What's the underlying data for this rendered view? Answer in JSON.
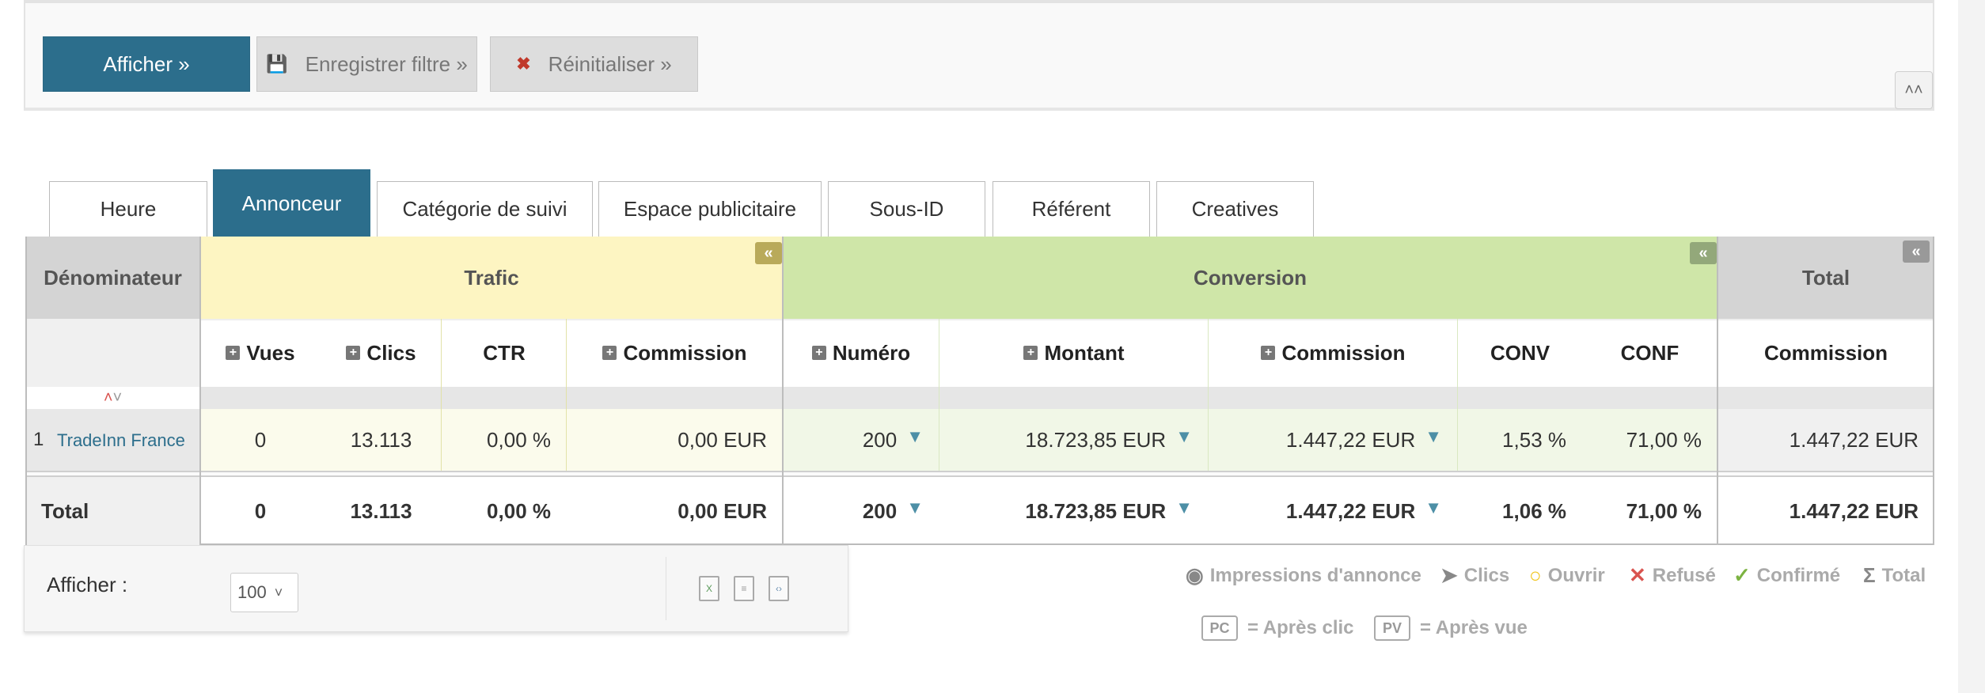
{
  "filter": {
    "show_btn": "Afficher »",
    "save_btn": "Enregistrer filtre »",
    "reset_btn": "Réinitialiser »",
    "collapse_icon": "double-chevron-up-icon"
  },
  "tabs": [
    {
      "label": "Heure",
      "active": false
    },
    {
      "label": "Annonceur",
      "active": true
    },
    {
      "label": "Catégorie de suivi",
      "active": false
    },
    {
      "label": "Espace publicitaire",
      "active": false
    },
    {
      "label": "Sous-ID",
      "active": false
    },
    {
      "label": "Référent",
      "active": false
    },
    {
      "label": "Creatives",
      "active": false
    }
  ],
  "table": {
    "groups": {
      "denominator": "Dénominateur",
      "traffic": "Trafic",
      "conversion": "Conversion",
      "total": "Total"
    },
    "columns": {
      "views": "Vues",
      "clicks": "Clics",
      "ctr": "CTR",
      "commission_traffic": "Commission",
      "number": "Numéro",
      "amount": "Montant",
      "commission_conv": "Commission",
      "conv": "CONV",
      "conf": "CONF",
      "commission_total": "Commission"
    },
    "rows": [
      {
        "index": "1",
        "name": "TradeInn France",
        "views": "0",
        "clicks": "13.113",
        "ctr": "0,00 %",
        "commission_traffic": "0,00 EUR",
        "number": "200",
        "amount": "18.723,85 EUR",
        "commission_conv": "1.447,22 EUR",
        "conv": "1,53 %",
        "conf": "71,00 %",
        "commission_total": "1.447,22 EUR"
      }
    ],
    "total": {
      "label": "Total",
      "views": "0",
      "clicks": "13.113",
      "ctr": "0,00 %",
      "commission_traffic": "0,00 EUR",
      "number": "200",
      "amount": "18.723,85 EUR",
      "commission_conv": "1.447,22 EUR",
      "conv": "1,06 %",
      "conf": "71,00 %",
      "commission_total": "1.447,22 EUR"
    },
    "colors": {
      "traffic_header": "#fdf5c2",
      "conversion_header": "#cfe6a8",
      "total_header": "#d4d4d4",
      "traffic_row": "#fbfbec",
      "conversion_row": "#f1f7e7",
      "total_row": "#f0f0f0"
    }
  },
  "footer": {
    "show_label": "Afficher :",
    "page_size": "100"
  },
  "legend": {
    "impressions": "Impressions d'annonce",
    "clicks": "Clics",
    "open": "Ouvrir",
    "refused": "Refusé",
    "confirmed": "Confirmé",
    "total": "Total",
    "pc_badge": "PC",
    "pc_text": "= Après clic",
    "pv_badge": "PV",
    "pv_text": "= Après vue"
  }
}
